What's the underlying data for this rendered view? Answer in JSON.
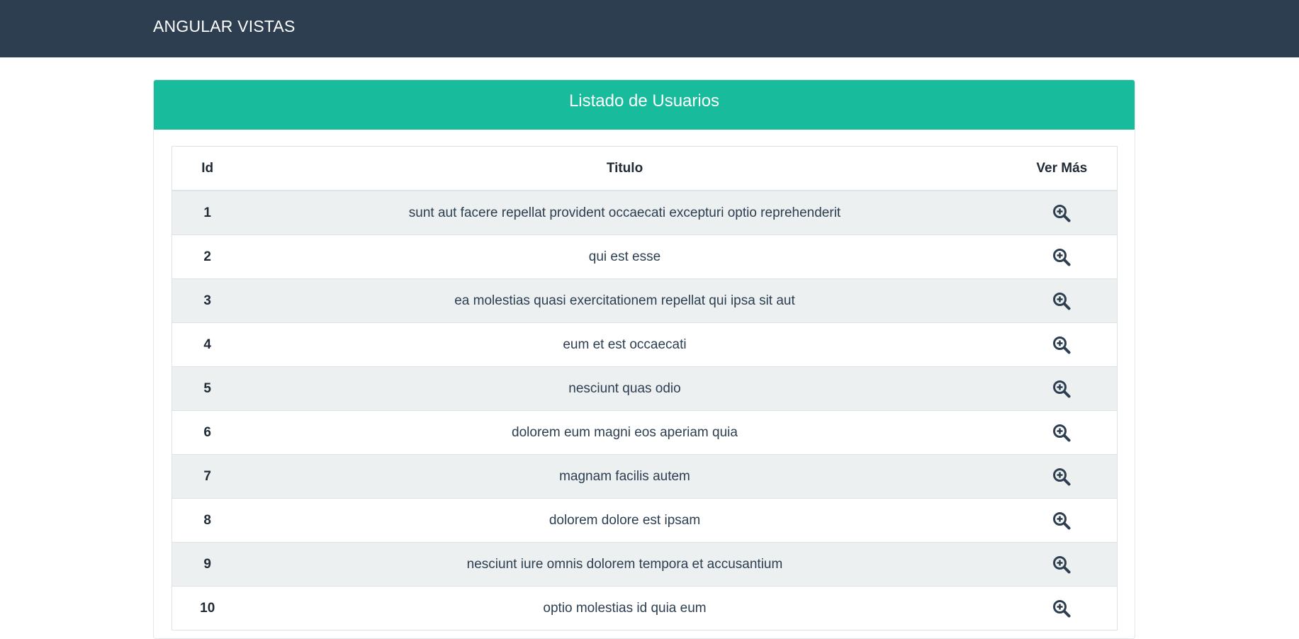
{
  "navbar": {
    "brand": "ANGULAR VISTAS"
  },
  "panel": {
    "title": "Listado de Usuarios"
  },
  "table": {
    "headers": {
      "id": "Id",
      "title": "Titulo",
      "more": "Ver Más"
    },
    "rows": [
      {
        "id": "1",
        "title": "sunt aut facere repellat provident occaecati excepturi optio reprehenderit",
        "action_icon": "zoom-in-icon"
      },
      {
        "id": "2",
        "title": "qui est esse",
        "action_icon": "zoom-in-icon"
      },
      {
        "id": "3",
        "title": "ea molestias quasi exercitationem repellat qui ipsa sit aut",
        "action_icon": "zoom-in-icon"
      },
      {
        "id": "4",
        "title": "eum et est occaecati",
        "action_icon": "zoom-in-icon"
      },
      {
        "id": "5",
        "title": "nesciunt quas odio",
        "action_icon": "zoom-in-icon"
      },
      {
        "id": "6",
        "title": "dolorem eum magni eos aperiam quia",
        "action_icon": "zoom-in-icon"
      },
      {
        "id": "7",
        "title": "magnam facilis autem",
        "action_icon": "zoom-in-icon"
      },
      {
        "id": "8",
        "title": "dolorem dolore est ipsam",
        "action_icon": "zoom-in-icon"
      },
      {
        "id": "9",
        "title": "nesciunt iure omnis dolorem tempora et accusantium",
        "action_icon": "zoom-in-icon"
      },
      {
        "id": "10",
        "title": "optio molestias id quia eum",
        "action_icon": "zoom-in-icon"
      }
    ]
  },
  "colors": {
    "navbar_bg": "#2c3e50",
    "panel_heading_bg": "#18bc9c",
    "striped_row_bg": "#ecf0f1",
    "icon_color": "#2c3e50"
  }
}
